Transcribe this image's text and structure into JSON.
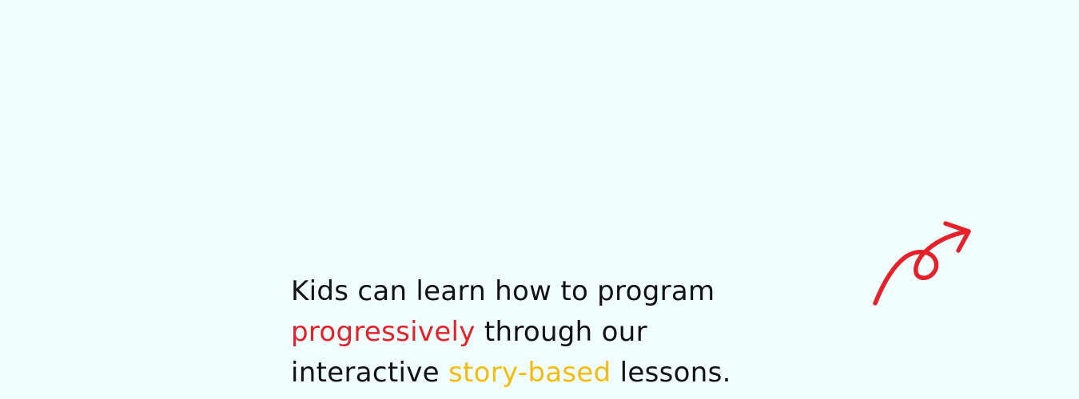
{
  "tagline": {
    "line1": "Kids can learn how to program",
    "line2_highlight": "progressively",
    "line2_rest": " through our",
    "line3_start": "interactive ",
    "line3_highlight": "story-based",
    "line3_end": " lessons."
  },
  "colors": {
    "background": "#f0fefe",
    "text": "#111111",
    "accent_red": "#e8202a",
    "accent_yellow": "#f7bb0d"
  },
  "icons": {
    "arrow": "hand-drawn-curly-arrow-icon"
  }
}
